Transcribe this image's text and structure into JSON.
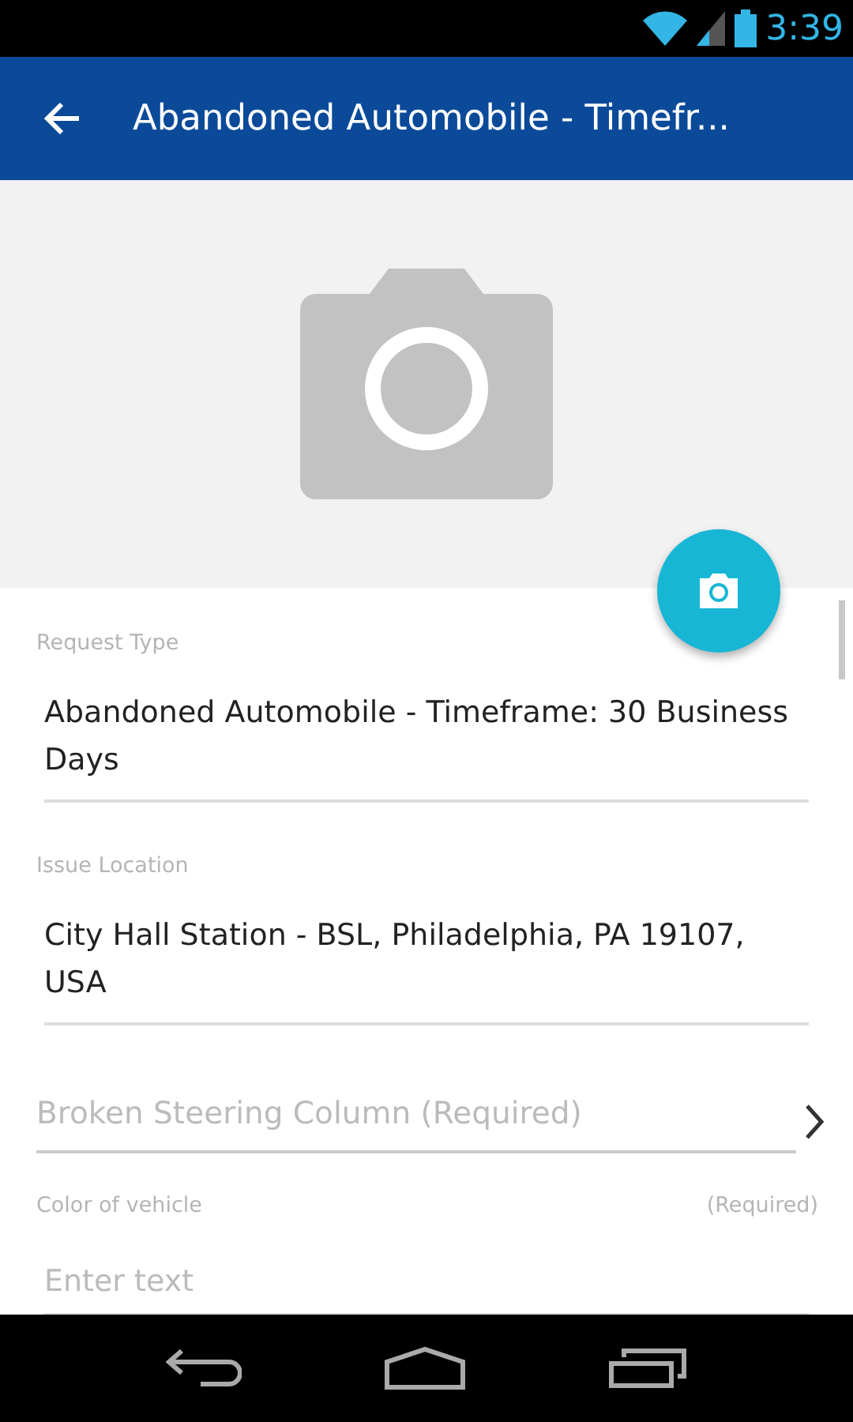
{
  "status_bar": {
    "time": "3:39"
  },
  "app_bar": {
    "title": "Abandoned Automobile - Timefr..."
  },
  "form": {
    "fields": [
      {
        "kind": "display",
        "label": "Request Type",
        "value": "Abandoned Automobile - Timeframe: 30 Business Days"
      },
      {
        "kind": "display",
        "label": "Issue Location",
        "value": "City Hall Station - BSL, Philadelphia, PA 19107, USA"
      },
      {
        "kind": "picker",
        "placeholder": "Broken Steering Column (Required)"
      },
      {
        "kind": "text",
        "label": "Color of vehicle",
        "required_note": "(Required)",
        "placeholder": "Enter text"
      }
    ]
  }
}
